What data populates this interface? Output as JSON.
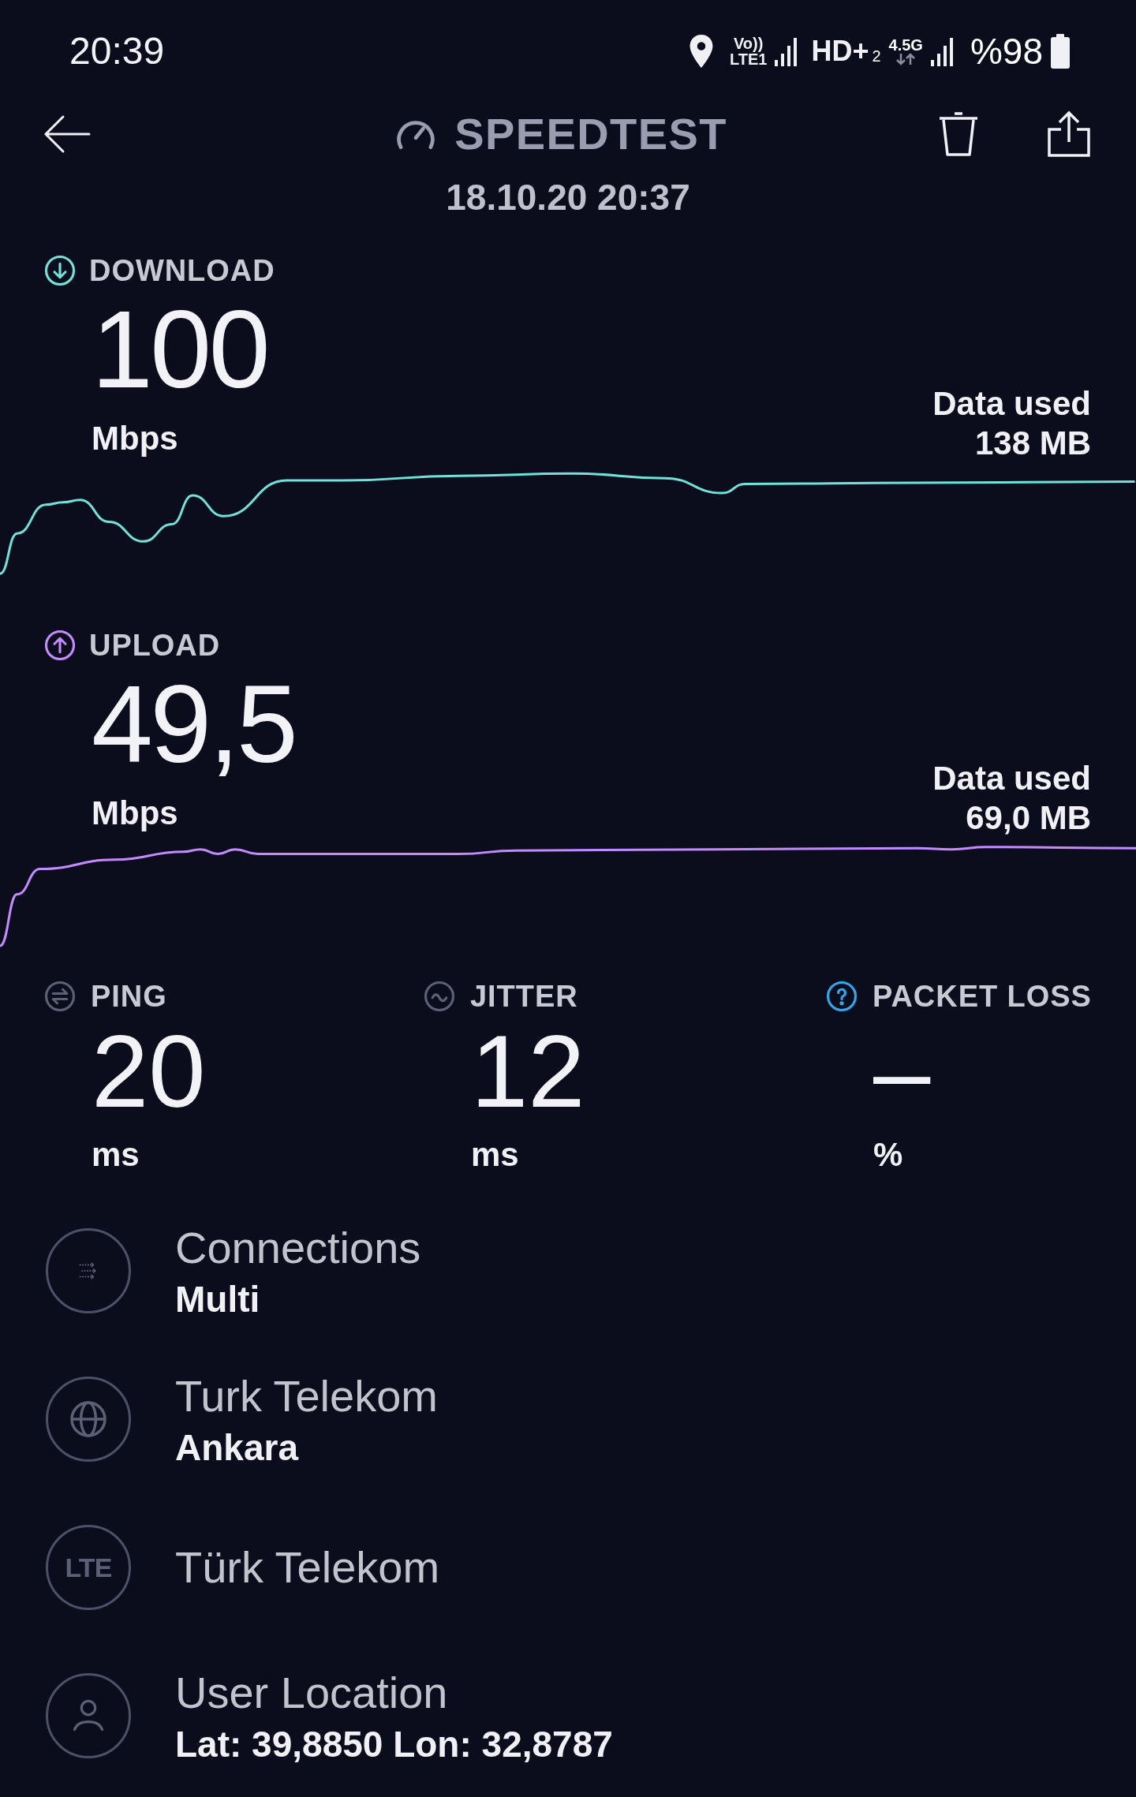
{
  "status_bar": {
    "time": "20:39",
    "volte": "Vo))",
    "lte": "LTE1",
    "hd": "HD+",
    "sim": "2",
    "network": "4.5G",
    "battery": "%98"
  },
  "header": {
    "title": "SPEEDTEST",
    "date": "18.10.20 20:37"
  },
  "results": [
    {
      "kind": "download",
      "label": "DOWNLOAD",
      "value": "100",
      "unit": "Mbps",
      "data_label": "Data used",
      "data_value": "138 MB"
    },
    {
      "kind": "upload",
      "label": "UPLOAD",
      "value": "49,5",
      "unit": "Mbps",
      "data_label": "Data used",
      "data_value": "69,0 MB"
    }
  ],
  "metrics": [
    {
      "kind": "ping",
      "label": "PING",
      "value": "20",
      "unit": "ms"
    },
    {
      "kind": "jitter",
      "label": "JITTER",
      "value": "12",
      "unit": "ms"
    },
    {
      "kind": "packet_loss",
      "label": "PACKET LOSS",
      "value": "–",
      "unit": "%"
    }
  ],
  "details": [
    {
      "kind": "connections",
      "title": "Connections",
      "subtitle": "Multi"
    },
    {
      "kind": "server",
      "title": "Turk Telekom",
      "subtitle": "Ankara"
    },
    {
      "kind": "network",
      "icon_text": "LTE",
      "title": "Türk Telekom"
    },
    {
      "kind": "location",
      "title": "User Location",
      "subtitle": "Lat: 39,8850 Lon: 32,8787"
    }
  ]
}
